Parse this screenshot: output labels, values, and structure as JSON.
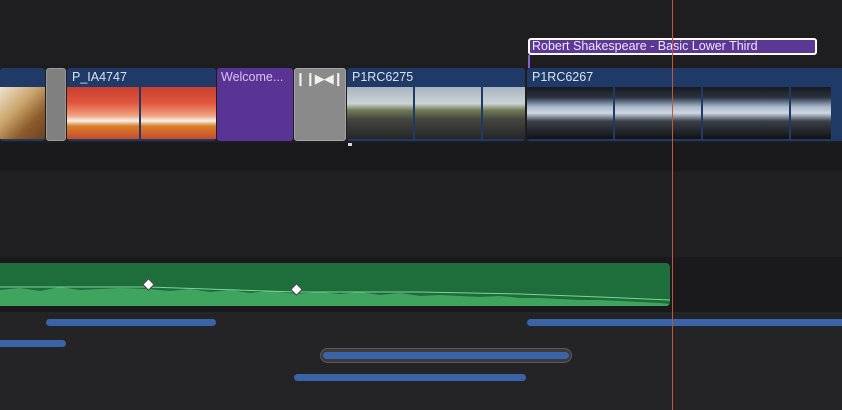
{
  "timeline": {
    "title_clip": {
      "label": "Robert Shakespeare - Basic Lower Third"
    },
    "clips": {
      "clip_1": {
        "label": "P_IA4747"
      },
      "clip_title": {
        "label": "Welcome..."
      },
      "clip_2": {
        "label": "P1RC6275"
      },
      "clip_3": {
        "label": "P1RC6267"
      }
    },
    "transition": {
      "glyph": "❙❙▶◀❙❙"
    },
    "colors": {
      "video_clip": "#1f3a66",
      "title_clip": "#5a3494",
      "audio_clip": "#1d6e3a",
      "playhead": "#c6543a",
      "secondary_bar": "#3b64a8"
    }
  }
}
